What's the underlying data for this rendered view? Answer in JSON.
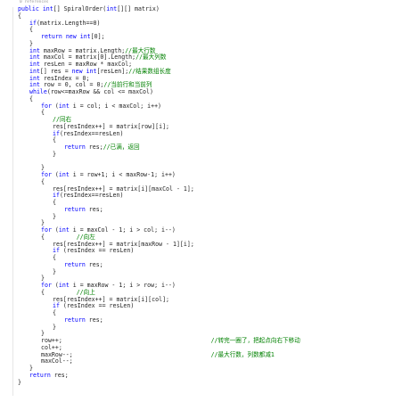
{
  "reference_hint": "0 references",
  "lines": [
    {
      "indent": 0,
      "tokens": [
        {
          "c": "kw",
          "t": "public"
        },
        {
          "c": "tx",
          "t": " "
        },
        {
          "c": "kw",
          "t": "int"
        },
        {
          "c": "tx",
          "t": "[] SpiralOrder("
        },
        {
          "c": "kw",
          "t": "int"
        },
        {
          "c": "tx",
          "t": "[][] matrix)"
        }
      ]
    },
    {
      "indent": 0,
      "tokens": [
        {
          "c": "tx",
          "t": "{"
        }
      ]
    },
    {
      "indent": 1,
      "tokens": [
        {
          "c": "kw",
          "t": "if"
        },
        {
          "c": "tx",
          "t": "(matrix.Length==0)"
        }
      ]
    },
    {
      "indent": 1,
      "tokens": [
        {
          "c": "tx",
          "t": "{"
        }
      ]
    },
    {
      "indent": 2,
      "tokens": [
        {
          "c": "kw",
          "t": "return"
        },
        {
          "c": "tx",
          "t": " "
        },
        {
          "c": "kw",
          "t": "new"
        },
        {
          "c": "tx",
          "t": " "
        },
        {
          "c": "kw",
          "t": "int"
        },
        {
          "c": "tx",
          "t": "[0];"
        }
      ]
    },
    {
      "indent": 1,
      "tokens": [
        {
          "c": "tx",
          "t": "}"
        }
      ]
    },
    {
      "indent": 1,
      "tokens": [
        {
          "c": "kw",
          "t": "int"
        },
        {
          "c": "tx",
          "t": " maxRow = matrix.Length;"
        },
        {
          "c": "cm",
          "t": "//最大行数"
        }
      ]
    },
    {
      "indent": 1,
      "tokens": [
        {
          "c": "kw",
          "t": "int"
        },
        {
          "c": "tx",
          "t": " maxCol = matrix[0].Length;"
        },
        {
          "c": "cm",
          "t": "//最大列数"
        }
      ]
    },
    {
      "indent": 1,
      "tokens": [
        {
          "c": "kw",
          "t": "int"
        },
        {
          "c": "tx",
          "t": " resLen = maxRow * maxCol;"
        }
      ]
    },
    {
      "indent": 1,
      "tokens": [
        {
          "c": "kw",
          "t": "int"
        },
        {
          "c": "tx",
          "t": "[] res = "
        },
        {
          "c": "kw",
          "t": "new"
        },
        {
          "c": "tx",
          "t": " "
        },
        {
          "c": "kw",
          "t": "int"
        },
        {
          "c": "tx",
          "t": "[resLen];"
        },
        {
          "c": "cm",
          "t": "//结果数组长度"
        }
      ]
    },
    {
      "indent": 1,
      "tokens": [
        {
          "c": "kw",
          "t": "int"
        },
        {
          "c": "tx",
          "t": " resIndex = 0;"
        }
      ]
    },
    {
      "indent": 1,
      "tokens": [
        {
          "c": "kw",
          "t": "int"
        },
        {
          "c": "tx",
          "t": " row = 0, col = 0;"
        },
        {
          "c": "cm",
          "t": "//当前行和当前列"
        }
      ]
    },
    {
      "indent": 1,
      "tokens": [
        {
          "c": "kw",
          "t": "while"
        },
        {
          "c": "tx",
          "t": "(row<=maxRow && col <= maxCol)"
        }
      ]
    },
    {
      "indent": 1,
      "tokens": [
        {
          "c": "tx",
          "t": "{"
        }
      ]
    },
    {
      "indent": 2,
      "tokens": [
        {
          "c": "kw",
          "t": "for"
        },
        {
          "c": "tx",
          "t": " ("
        },
        {
          "c": "kw",
          "t": "int"
        },
        {
          "c": "tx",
          "t": " i = col; i < maxCol; i++)"
        }
      ]
    },
    {
      "indent": 2,
      "tokens": [
        {
          "c": "tx",
          "t": "{"
        }
      ]
    },
    {
      "indent": 3,
      "tokens": [
        {
          "c": "cm",
          "t": "//同右"
        }
      ]
    },
    {
      "indent": 3,
      "tokens": [
        {
          "c": "tx",
          "t": "res[resIndex++] = matrix[row][i];"
        }
      ]
    },
    {
      "indent": 3,
      "tokens": [
        {
          "c": "kw",
          "t": "if"
        },
        {
          "c": "tx",
          "t": "(resIndex==resLen)"
        }
      ]
    },
    {
      "indent": 3,
      "tokens": [
        {
          "c": "tx",
          "t": "{"
        }
      ]
    },
    {
      "indent": 4,
      "tokens": [
        {
          "c": "kw",
          "t": "return"
        },
        {
          "c": "tx",
          "t": " res;"
        },
        {
          "c": "cm",
          "t": "//已满，返回"
        }
      ]
    },
    {
      "indent": 3,
      "tokens": [
        {
          "c": "tx",
          "t": "}"
        }
      ]
    },
    {
      "indent": 0,
      "tokens": []
    },
    {
      "indent": 2,
      "tokens": [
        {
          "c": "tx",
          "t": "}"
        }
      ]
    },
    {
      "indent": 2,
      "tokens": [
        {
          "c": "kw",
          "t": "for"
        },
        {
          "c": "tx",
          "t": " ("
        },
        {
          "c": "kw",
          "t": "int"
        },
        {
          "c": "tx",
          "t": " i = row+1; i < maxRow-1; i++)"
        }
      ]
    },
    {
      "indent": 2,
      "tokens": [
        {
          "c": "tx",
          "t": "{"
        }
      ]
    },
    {
      "indent": 3,
      "tokens": [
        {
          "c": "tx",
          "t": "res[resIndex++] = matrix[i][maxCol - 1];"
        }
      ]
    },
    {
      "indent": 3,
      "tokens": [
        {
          "c": "kw",
          "t": "if"
        },
        {
          "c": "tx",
          "t": "(resIndex==resLen)"
        }
      ]
    },
    {
      "indent": 3,
      "tokens": [
        {
          "c": "tx",
          "t": "{"
        }
      ]
    },
    {
      "indent": 4,
      "tokens": [
        {
          "c": "kw",
          "t": "return"
        },
        {
          "c": "tx",
          "t": " res;"
        }
      ]
    },
    {
      "indent": 3,
      "tokens": [
        {
          "c": "tx",
          "t": "}"
        }
      ]
    },
    {
      "indent": 2,
      "tokens": [
        {
          "c": "tx",
          "t": "}"
        }
      ]
    },
    {
      "indent": 2,
      "tokens": [
        {
          "c": "kw",
          "t": "for"
        },
        {
          "c": "tx",
          "t": " ("
        },
        {
          "c": "kw",
          "t": "int"
        },
        {
          "c": "tx",
          "t": " i = maxCol - 1; i > col; i--)"
        }
      ]
    },
    {
      "indent": 2,
      "tokens": [
        {
          "c": "tx",
          "t": "{         "
        },
        {
          "c": "cm",
          "t": "//向左"
        }
      ]
    },
    {
      "indent": 3,
      "tokens": [
        {
          "c": "tx",
          "t": "res[resIndex++] = matrix[maxRow - 1][i];"
        }
      ]
    },
    {
      "indent": 3,
      "tokens": [
        {
          "c": "kw",
          "t": "if"
        },
        {
          "c": "tx",
          "t": " (resIndex == resLen)"
        }
      ]
    },
    {
      "indent": 3,
      "tokens": [
        {
          "c": "tx",
          "t": "{"
        }
      ]
    },
    {
      "indent": 4,
      "tokens": [
        {
          "c": "kw",
          "t": "return"
        },
        {
          "c": "tx",
          "t": " res;"
        }
      ]
    },
    {
      "indent": 3,
      "tokens": [
        {
          "c": "tx",
          "t": "}"
        }
      ]
    },
    {
      "indent": 2,
      "tokens": [
        {
          "c": "tx",
          "t": "}"
        }
      ]
    },
    {
      "indent": 2,
      "tokens": [
        {
          "c": "kw",
          "t": "for"
        },
        {
          "c": "tx",
          "t": " ("
        },
        {
          "c": "kw",
          "t": "int"
        },
        {
          "c": "tx",
          "t": " i = maxRow - 1; i > row; i--)"
        }
      ]
    },
    {
      "indent": 2,
      "tokens": [
        {
          "c": "tx",
          "t": "{         "
        },
        {
          "c": "cm",
          "t": "//向上"
        }
      ]
    },
    {
      "indent": 3,
      "tokens": [
        {
          "c": "tx",
          "t": "res[resIndex++] = matrix[i][col];"
        }
      ]
    },
    {
      "indent": 3,
      "tokens": [
        {
          "c": "kw",
          "t": "if"
        },
        {
          "c": "tx",
          "t": " (resIndex == resLen)"
        }
      ]
    },
    {
      "indent": 3,
      "tokens": [
        {
          "c": "tx",
          "t": "{"
        }
      ]
    },
    {
      "indent": 4,
      "tokens": [
        {
          "c": "kw",
          "t": "return"
        },
        {
          "c": "tx",
          "t": " res;"
        }
      ]
    },
    {
      "indent": 3,
      "tokens": [
        {
          "c": "tx",
          "t": "}"
        }
      ]
    },
    {
      "indent": 2,
      "tokens": [
        {
          "c": "tx",
          "t": "}"
        }
      ]
    },
    {
      "indent": 2,
      "tokens": [
        {
          "c": "tx",
          "t": "row++;                                          "
        },
        {
          "c": "cm",
          "t": "//转完一圈了，把起点向右下移动"
        }
      ]
    },
    {
      "indent": 2,
      "tokens": [
        {
          "c": "tx",
          "t": "col++;"
        }
      ]
    },
    {
      "indent": 2,
      "tokens": [
        {
          "c": "tx",
          "t": "maxRow--;                                       "
        },
        {
          "c": "cm",
          "t": "//最大行数，列数都减1"
        }
      ]
    },
    {
      "indent": 2,
      "tokens": [
        {
          "c": "tx",
          "t": "maxCol--;"
        }
      ]
    },
    {
      "indent": 1,
      "tokens": [
        {
          "c": "tx",
          "t": "}"
        }
      ]
    },
    {
      "indent": 1,
      "tokens": [
        {
          "kw": 1,
          "c": "kw",
          "t": "return"
        },
        {
          "c": "tx",
          "t": " res;"
        }
      ]
    },
    {
      "indent": 0,
      "tokens": [
        {
          "c": "tx",
          "t": "}"
        }
      ]
    }
  ]
}
